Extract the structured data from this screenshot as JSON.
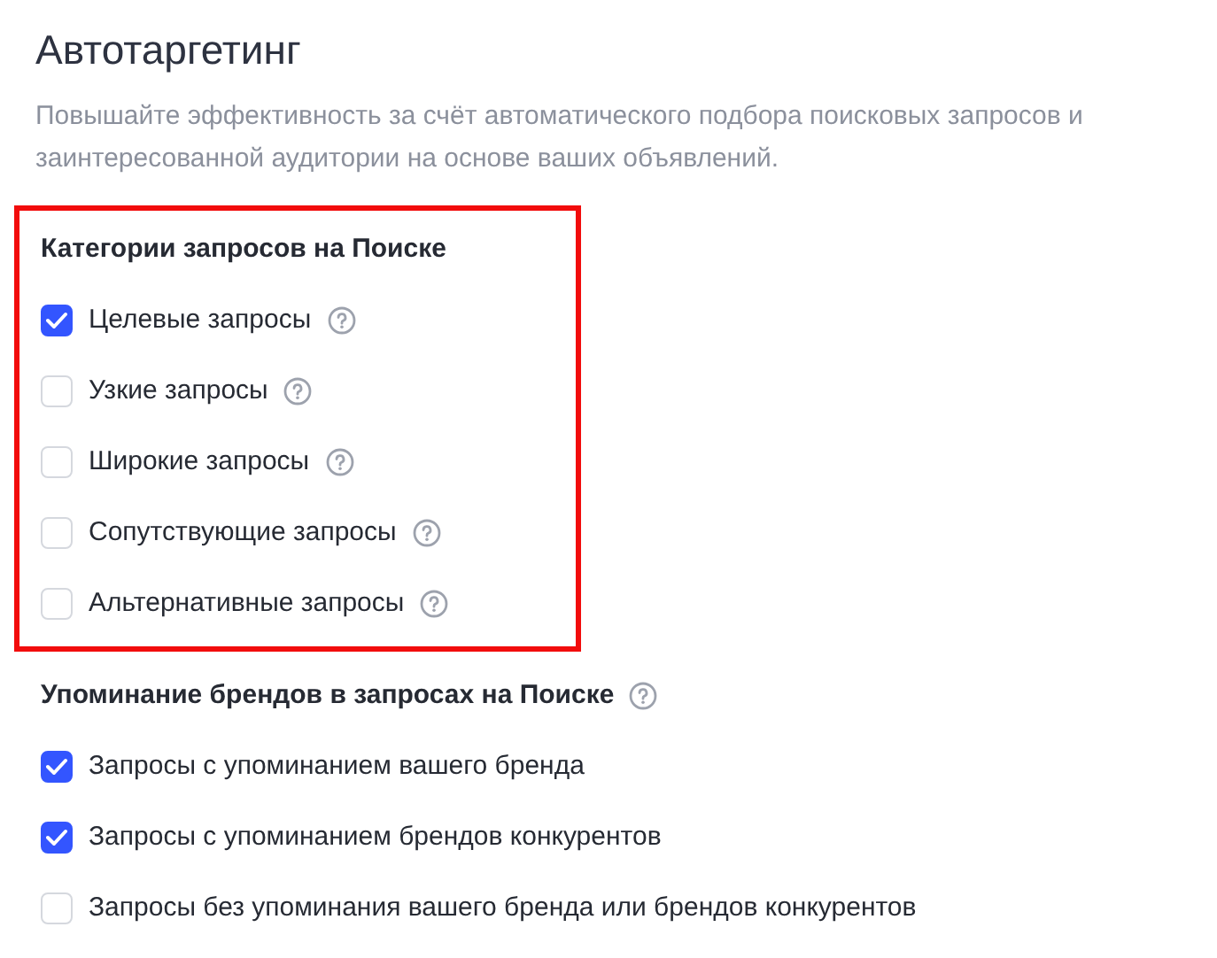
{
  "title": "Автотаргетинг",
  "description": "Повышайте эффективность за счёт автоматического подбора поисковых запросов и заинтересованной аудитории на основе ваших объявлений.",
  "groups": [
    {
      "heading": "Категории запросов на Поиске",
      "help": false,
      "highlighted": true,
      "options": [
        {
          "label": "Целевые запросы",
          "checked": true,
          "help": true
        },
        {
          "label": "Узкие запросы",
          "checked": false,
          "help": true
        },
        {
          "label": "Широкие запросы",
          "checked": false,
          "help": true
        },
        {
          "label": "Сопутствующие запросы",
          "checked": false,
          "help": true
        },
        {
          "label": "Альтернативные запросы",
          "checked": false,
          "help": true
        }
      ]
    },
    {
      "heading": "Упоминание брендов в запросах на Поиске",
      "help": true,
      "highlighted": false,
      "options": [
        {
          "label": "Запросы с упоминанием вашего бренда",
          "checked": true,
          "help": false
        },
        {
          "label": "Запросы с упоминанием брендов конкурентов",
          "checked": true,
          "help": false
        },
        {
          "label": "Запросы без упоминания вашего бренда или брендов конкурентов",
          "checked": false,
          "help": false
        }
      ]
    }
  ]
}
